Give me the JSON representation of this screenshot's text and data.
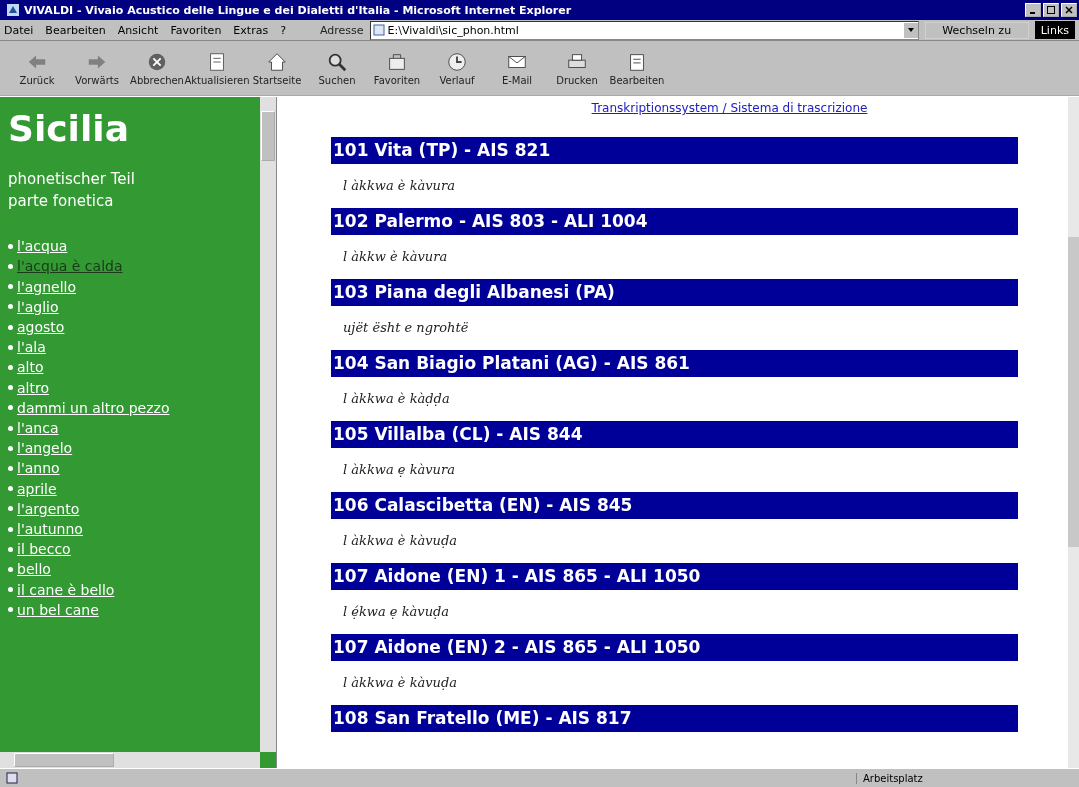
{
  "window": {
    "title": "VIVALDI - Vivaio Acustico delle Lingue e dei Dialetti d'Italia - Microsoft Internet Explorer"
  },
  "menu": [
    "Datei",
    "Bearbeiten",
    "Ansicht",
    "Favoriten",
    "Extras",
    "?"
  ],
  "address": {
    "label": "Adresse",
    "value": "E:\\Vivaldi\\sic_phon.html",
    "go": "Wechseln zu",
    "links": "Links"
  },
  "toolbar": [
    {
      "label": "Zurück",
      "kind": "back"
    },
    {
      "label": "Vorwärts",
      "kind": "forward"
    },
    {
      "label": "Abbrechen",
      "kind": "stop"
    },
    {
      "label": "Aktualisieren",
      "kind": "refresh"
    },
    {
      "label": "Startseite",
      "kind": "home"
    },
    {
      "label": "Suchen",
      "kind": "search"
    },
    {
      "label": "Favoriten",
      "kind": "favorites"
    },
    {
      "label": "Verlauf",
      "kind": "history"
    },
    {
      "label": "E-Mail",
      "kind": "mail"
    },
    {
      "label": "Drucken",
      "kind": "print"
    },
    {
      "label": "Bearbeiten",
      "kind": "edit"
    }
  ],
  "sidebar": {
    "title": "Sicilia",
    "subtitle": [
      "phonetischer Teil",
      "parte fonetica"
    ],
    "items": [
      {
        "label": "l'acqua",
        "visited": false
      },
      {
        "label": "l'acqua è calda",
        "visited": true
      },
      {
        "label": "l'agnello",
        "visited": false
      },
      {
        "label": "l'aglio",
        "visited": false
      },
      {
        "label": "agosto",
        "visited": false
      },
      {
        "label": "l'ala",
        "visited": false
      },
      {
        "label": "alto",
        "visited": false
      },
      {
        "label": "altro",
        "visited": false
      },
      {
        "label": "dammi un altro pezzo",
        "visited": false
      },
      {
        "label": "l'anca",
        "visited": false
      },
      {
        "label": "l'angelo",
        "visited": false
      },
      {
        "label": "l'anno",
        "visited": false
      },
      {
        "label": "aprile",
        "visited": false
      },
      {
        "label": "l'argento",
        "visited": false
      },
      {
        "label": "l'autunno",
        "visited": false
      },
      {
        "label": "il becco",
        "visited": false
      },
      {
        "label": "bello",
        "visited": false
      },
      {
        "label": "il cane è bello",
        "visited": false
      },
      {
        "label": "un bel cane",
        "visited": false
      }
    ]
  },
  "main": {
    "link": "Transkriptionssystem / Sistema di trascrizione",
    "entries": [
      {
        "heading": "101 Vita (TP) - AIS 821",
        "transcription": "l àkkwa è kàvura"
      },
      {
        "heading": "102 Palermo - AIS 803 - ALI 1004",
        "transcription": "l àkkw è kàvura"
      },
      {
        "heading": "103 Piana degli Albanesi (PA)",
        "transcription": "ujët ësht e ngrohtë"
      },
      {
        "heading": "104 San Biagio Platani (AG) - AIS 861",
        "transcription": "l àkkwa è kàḍḍa"
      },
      {
        "heading": "105 Villalba (CL) - AIS 844",
        "transcription": "l àkkwa ẹ kàvura"
      },
      {
        "heading": "106 Calascibetta (EN) - AIS 845",
        "transcription": "l àkkwa è kàvuḍa"
      },
      {
        "heading": "107 Aidone (EN) 1 - AIS 865 - ALI 1050",
        "transcription": "l ẹ́kwa ẹ kàvuḍa"
      },
      {
        "heading": "107 Aidone (EN) 2 - AIS 865 - ALI 1050",
        "transcription": "l àkkwa è kàvuḍa"
      },
      {
        "heading": "108 San Fratello (ME) - AIS 817"
      }
    ]
  },
  "status_bar": {
    "zone": "Arbeitsplatz"
  }
}
